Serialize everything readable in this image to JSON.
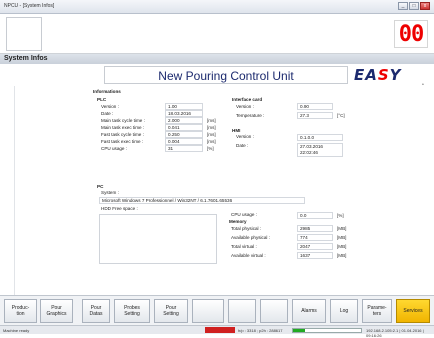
{
  "window": {
    "title": "NPCU - [System Infos]",
    "controls": [
      "_",
      "□",
      "x"
    ]
  },
  "counter": "00",
  "section_title": "System Infos",
  "header": {
    "title": "New Pouring Control Unit",
    "logo_pre": "EA",
    "logo_mid": "S",
    "logo_post": "Y",
    "logo_sub": "a"
  },
  "informations": {
    "title": "Informations",
    "plc": {
      "title": "PLC",
      "rows": [
        {
          "label": "Version :",
          "value": "1.00",
          "unit": ""
        },
        {
          "label": "Date :",
          "value": "18.03.2016",
          "unit": ""
        },
        {
          "label": "Main task cycle time :",
          "value": "2.000",
          "unit": "[ms]"
        },
        {
          "label": "Main task exec time :",
          "value": "0.041",
          "unit": "[ms]"
        },
        {
          "label": "Fast task cycle time :",
          "value": "0.250",
          "unit": "[ms]"
        },
        {
          "label": "Fast task exec time :",
          "value": "0.004",
          "unit": "[ms]"
        },
        {
          "label": "CPU usage :",
          "value": "31",
          "unit": "[%]"
        }
      ]
    },
    "interface_card": {
      "title": "Interface card",
      "rows": [
        {
          "label": "Version :",
          "value": "0.90",
          "unit": ""
        },
        {
          "label": "Temperature :",
          "value": "27.3",
          "unit": "[°C]"
        }
      ]
    },
    "hmi": {
      "title": "HMI",
      "version_label": "Version :",
      "version": "0.1.0.0",
      "date_label": "Date :",
      "date": "27.03.2016",
      "time": "22:02:46"
    }
  },
  "pc": {
    "title": "PC",
    "system_label": "System :",
    "system": "Microsoft Windows 7 Professionnel  / Win32NT / 6.1.7601.65536",
    "hdd_label": "HDD Free space :",
    "cpu_label": "CPU usage :",
    "cpu_value": "0.0",
    "cpu_unit": "[%]",
    "memory": {
      "title": "Memory",
      "rows": [
        {
          "label": "Total physical :",
          "value": "2985",
          "unit": "[MB]"
        },
        {
          "label": "Available physical :",
          "value": "774",
          "unit": "[MB]"
        },
        {
          "label": "Total virtual :",
          "value": "2047",
          "unit": "[MB]"
        },
        {
          "label": "Available virtual :",
          "value": "1637",
          "unit": "[MB]"
        }
      ]
    }
  },
  "nav": {
    "buttons": [
      {
        "label": "Produc-\ntion"
      },
      {
        "label": "Pour\nGraphics"
      },
      {
        "label": "Pour\nDatas"
      },
      {
        "label": "Probes\nSetting"
      },
      {
        "label": "Pour\nSetting"
      },
      {
        "label": ""
      },
      {
        "label": ""
      },
      {
        "label": ""
      },
      {
        "label": "Alarms"
      },
      {
        "label": "Log"
      },
      {
        "label": "Parame-\nters"
      },
      {
        "label": "Services"
      }
    ],
    "active_index": 11
  },
  "status": {
    "left": "Machine ready",
    "info": "h/p : 3318  ;  p2h : 288617",
    "progress_fraction": 0.18,
    "right": "192.168.2.105:2.1  |  01.04.2016  |  09:16:26"
  },
  "colors": {
    "accent_red": "#e00000",
    "services_yellow": "#f6c400",
    "title_navy": "#1c2a6e",
    "progress_green": "#22aa22"
  }
}
